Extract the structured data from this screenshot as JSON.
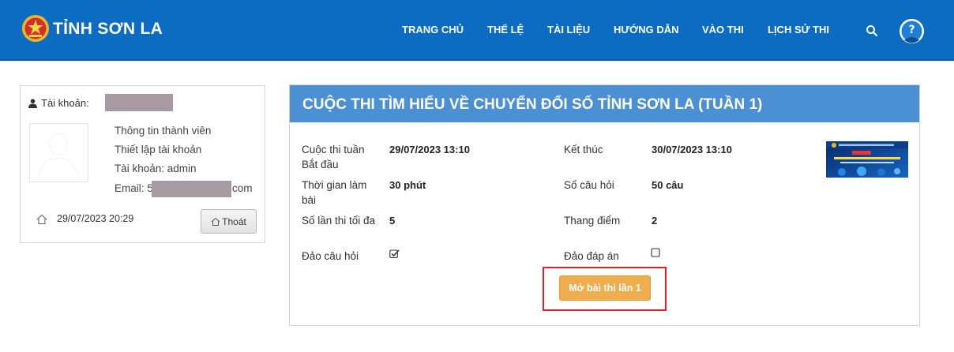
{
  "header": {
    "site_title": "TỈNH SƠN LA",
    "nav": [
      {
        "label": "TRANG CHỦ"
      },
      {
        "label": "THỂ LỆ"
      },
      {
        "label": "TÀI LIỆU"
      },
      {
        "label": "HƯỚNG DẪN"
      },
      {
        "label": "VÀO THI"
      },
      {
        "label": "LỊCH SỬ THI"
      }
    ],
    "icons": {
      "search": "search-icon",
      "help": "question-avatar-icon"
    },
    "colors": {
      "header_bg": "#0b6cc2",
      "title_bar": "#4a90d2",
      "start_button": "#f0ad4e",
      "highlight": "#e0202a"
    }
  },
  "account": {
    "account_label": "Tài khoản:",
    "links": [
      "Thông tin thành viên",
      "Thiết lập tài khoản"
    ],
    "username_line": "Tài khoản: admin",
    "email_prefix": "Email: 5",
    "email_suffix": "com",
    "last_login": "29/07/2023 20:29",
    "logout_label": "Thoát"
  },
  "contest": {
    "title": "CUỘC THI TÌM HIỂU VỀ CHUYỂN ĐỔI SỐ TỈNH SƠN LA (TUẦN 1)",
    "rows": [
      {
        "label1": "Cuộc thi tuần Bắt đầu",
        "value1": "29/07/2023 13:10",
        "label2": "Kết thúc",
        "value2": "30/07/2023 13:10"
      },
      {
        "label1": "Thời gian làm bài",
        "value1": "30 phút",
        "label2": "Số câu hỏi",
        "value2": "50 câu"
      },
      {
        "label1": "Số lần thi tối đa",
        "value1": "5",
        "label2": "Thang điểm",
        "value2": "2"
      },
      {
        "label1": "Đảo câu hỏi",
        "checked1": true,
        "label2": "Đảo đáp án",
        "checked2": false
      }
    ],
    "start_button_label": "Mở bài thi lần 1"
  }
}
